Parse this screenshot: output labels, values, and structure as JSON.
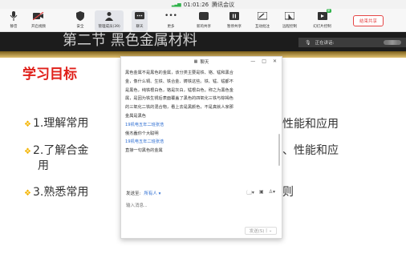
{
  "titlebar": {
    "time": "01:01:26",
    "app_name": "腾讯会议"
  },
  "toolbar": {
    "items": [
      {
        "label": "静音"
      },
      {
        "label": "开启视频"
      },
      {
        "label": "安全"
      },
      {
        "label": "管理成员(39)"
      },
      {
        "label": "聊天"
      },
      {
        "label": "更多"
      },
      {
        "label": "新的共享"
      },
      {
        "label": "暂停共享"
      },
      {
        "label": "互动批注"
      },
      {
        "label": "远程控制"
      },
      {
        "label": "幻灯片控制"
      }
    ],
    "badge": "新",
    "end_share_label": "结束共享"
  },
  "slide": {
    "title": "第二节 黑色金属材料",
    "section_heading": "学习目标",
    "bullets": [
      {
        "num": "1.",
        "text": "理解常用"
      },
      {
        "num": "2.",
        "text": "了解合金"
      },
      {
        "num": "3.",
        "text": "熟悉常用"
      }
    ],
    "wrap_text": "用",
    "right_fragments": [
      "性能和应用",
      "、性能和应",
      "则"
    ]
  },
  "speaking": {
    "label": "正在讲话:"
  },
  "chat": {
    "title": "聊天",
    "messages": [
      {
        "text": "黑色金属不是黑色的金属，该分类主要是铁、铬、锰和黑合"
      },
      {
        "text": "金，像什么铜、生铁、铁合金、铸铁这些。铁、锰、锰都不"
      },
      {
        "text": "是黑色，纯铁根白色，铬是灰白，锰根白色。称之为黑色金"
      },
      {
        "text": "属，是因为铁生锈后表面覆盖了黑色的四氧化三铁与棕褐色"
      },
      {
        "text": "的三氧化二铁的混合物，看上去是黑颜色，不是真就人家那"
      },
      {
        "text": "金属是黑色"
      },
      {
        "name": "19机电五年二班张浩"
      },
      {
        "text": "俄杰蠢你个大聪明"
      },
      {
        "name": "19机电五年二班张浩"
      },
      {
        "text": "直接一句黑色的金属"
      }
    ],
    "send_to_label": "发送至:",
    "send_to_value": "所有人",
    "input_placeholder": "输入消息...",
    "send_button": "发送(S)"
  }
}
